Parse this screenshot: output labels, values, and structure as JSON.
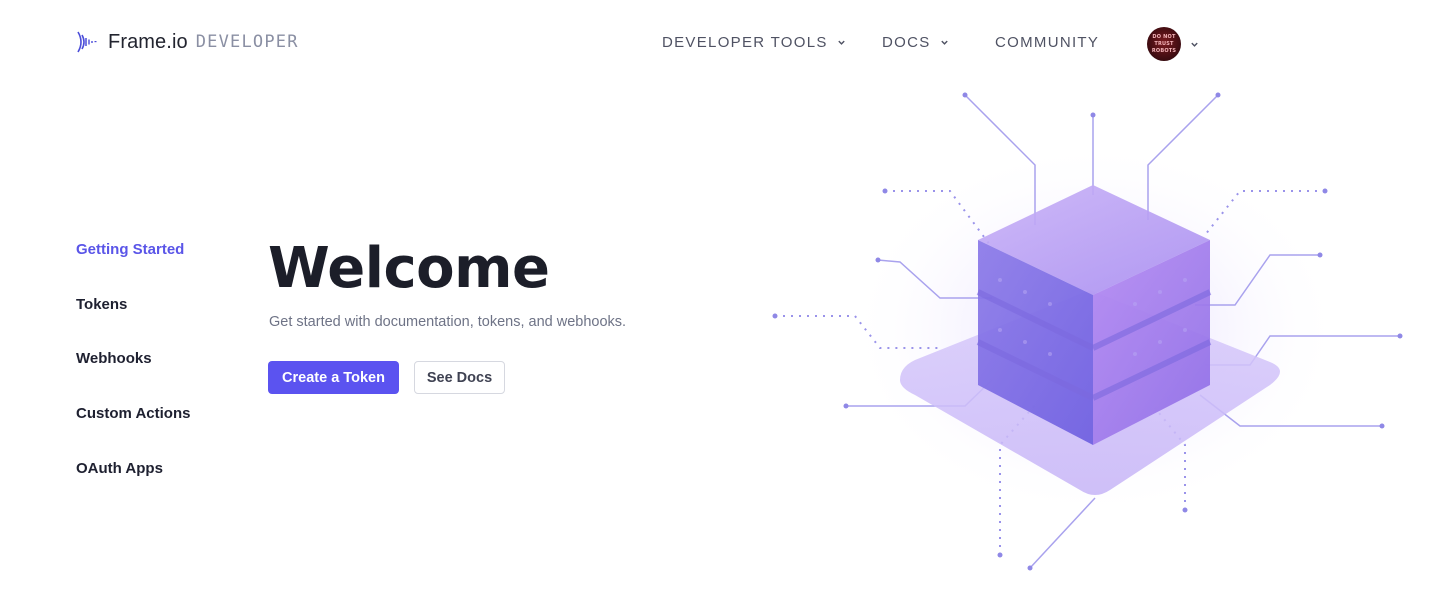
{
  "brand": {
    "name": "Frame.io",
    "sub": "DEVELOPER",
    "logo_icon": "frameio-waves-icon"
  },
  "nav": {
    "items": [
      {
        "label": "DEVELOPER TOOLS",
        "has_dropdown": true
      },
      {
        "label": "DOCS",
        "has_dropdown": true
      },
      {
        "label": "COMMUNITY",
        "has_dropdown": false
      }
    ],
    "avatar_text": [
      "DO NOT",
      "TRUST",
      "ROBOTS"
    ]
  },
  "sidebar": {
    "items": [
      {
        "label": "Getting Started",
        "active": true
      },
      {
        "label": "Tokens",
        "active": false
      },
      {
        "label": "Webhooks",
        "active": false
      },
      {
        "label": "Custom Actions",
        "active": false
      },
      {
        "label": "OAuth Apps",
        "active": false
      }
    ]
  },
  "hero": {
    "title": "Welcome",
    "subtitle": "Get started with documentation, tokens, and webhooks.",
    "primary_button": "Create a Token",
    "secondary_button": "See Docs"
  },
  "colors": {
    "accent": "#5b53f0",
    "active_link": "#5a55e8",
    "illustration_purple": "#9b7bf0"
  }
}
